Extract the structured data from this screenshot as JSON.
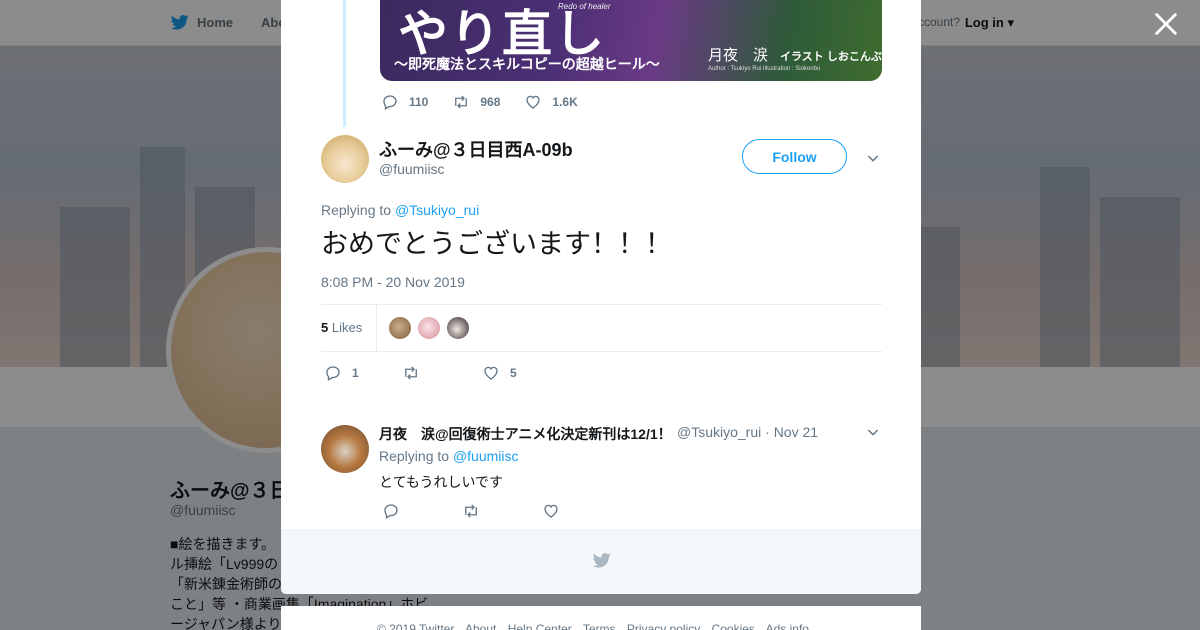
{
  "nav": {
    "home": "Home",
    "about": "Abo",
    "account_prompt": "ccount?",
    "login": "Log in"
  },
  "background_profile": {
    "name": "ふーみ@３日",
    "handle": "@fuumiisc",
    "bio_lines": [
      "■絵を描きます。",
      "ル挿絵「Lv999の",
      "「新米錬金術師の",
      "こと」等 ・商業画集「Imagination」ホビ",
      "ージャパン様より"
    ]
  },
  "previous_tweet": {
    "media": {
      "title": "やり直し",
      "subtitle": "〜即死魔法とスキルコピーの超越ヒール〜",
      "english": "Redo of healer",
      "author": "月夜　涙",
      "illustrator": "イラスト しおこんぶ",
      "credit": "Author : Tsukiyo Rui   Illustration : Siokonbu"
    },
    "replies": "110",
    "retweets": "968",
    "likes": "1.6K"
  },
  "main_tweet": {
    "display_name": "ふーみ@３日目西A-09b",
    "handle": "@fuumiisc",
    "follow_label": "Follow",
    "replying_prefix": "Replying to",
    "replying_to": "@Tsukiyo_rui",
    "text": "おめでとうございます！！！",
    "timestamp": "8:08 PM - 20 Nov 2019",
    "likes_number": "5",
    "likes_label": "Likes",
    "replies": "1",
    "retweets": "",
    "likes": "5"
  },
  "reply_tweet": {
    "display_name": "月夜　涙@回復術士アニメ化決定新刊は12/1！",
    "handle": "@Tsukiyo_rui",
    "date": "· Nov 21",
    "replying_prefix": "Replying to",
    "replying_to": "@fuumiisc",
    "text": "とてもうれしいです"
  },
  "footer": {
    "links": [
      "© 2019 Twitter",
      "About",
      "Help Center",
      "Terms",
      "Privacy policy",
      "Cookies",
      "Ads info"
    ]
  },
  "colors": {
    "brand": "#1da1f2",
    "secondary_text": "#657786",
    "border": "#e6ecf0"
  },
  "icons": [
    "twitter-bird-icon",
    "close-icon",
    "reply-icon",
    "retweet-icon",
    "heart-icon",
    "chevron-down-icon"
  ]
}
